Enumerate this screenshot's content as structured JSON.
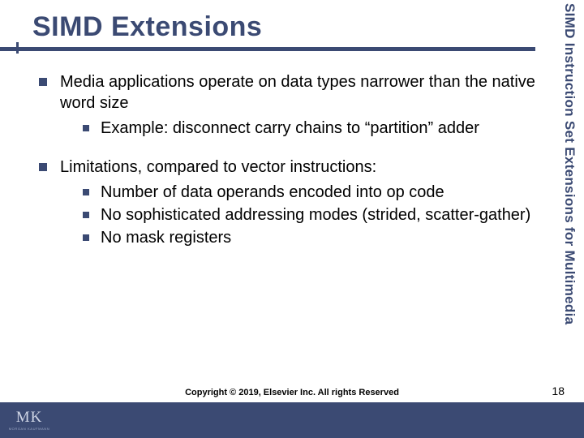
{
  "title": "SIMD Extensions",
  "side_label": "SIMD Instruction Set Extensions for Multimedia",
  "bullets": [
    {
      "text": "Media applications operate on data types narrower than the native word size",
      "sub": [
        "Example:  disconnect carry chains to “partition” adder"
      ]
    },
    {
      "text": "Limitations, compared to vector instructions:",
      "sub": [
        "Number of data operands encoded into op code",
        "No sophisticated addressing modes (strided, scatter-gather)",
        "No mask registers"
      ]
    }
  ],
  "copyright": "Copyright © 2019, Elsevier Inc. All rights Reserved",
  "page_number": "18",
  "logo": {
    "top": "MK",
    "bottom": "MORGAN KAUFMANN"
  }
}
